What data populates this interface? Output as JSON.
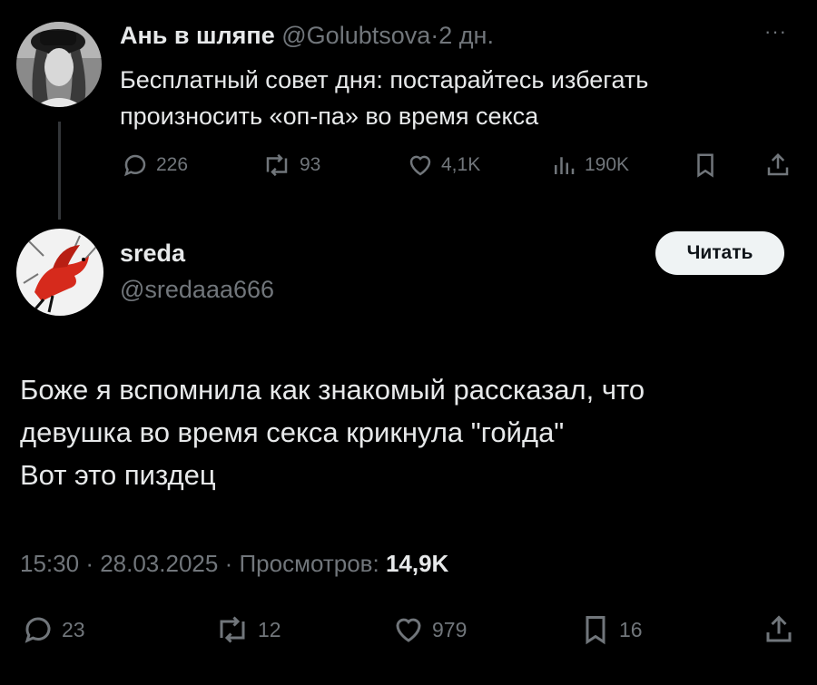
{
  "parent_tweet": {
    "author_name": "Ань в шляпе",
    "author_handle": "@Golubtsova",
    "separator": "·",
    "time_ago": "2 дн.",
    "more_label": "···",
    "text_line1": "Бесплатный совет дня: постарайтесь избегать",
    "text_line2": "произносить «оп-па» во время секса",
    "stats": {
      "replies": "226",
      "reposts": "93",
      "likes": "4,1K",
      "views": "190K"
    }
  },
  "main_tweet": {
    "author_name": "sreda",
    "author_handle": "@sredaaa666",
    "follow_label": "Читать",
    "text_line1": "Боже я вспомнила как знакомый рассказал, что",
    "text_line2": "девушка во время секса крикнула \"гойда\"",
    "text_line3": "Вот это пиздец",
    "time": "15:30",
    "date": "28.03.2025",
    "views_label": "Просмотров:",
    "views_count": "14,9K",
    "stats": {
      "replies": "23",
      "reposts": "12",
      "likes": "979",
      "bookmarks": "16"
    }
  },
  "icons": [
    "reply-icon",
    "repost-icon",
    "like-icon",
    "views-icon",
    "bookmark-icon",
    "share-icon"
  ],
  "colors": {
    "background": "#000000",
    "text": "#e7e9ea",
    "secondary_text": "#71767b",
    "follow_button_bg": "#eff3f4",
    "avatar_bird": "#d62a1c"
  }
}
